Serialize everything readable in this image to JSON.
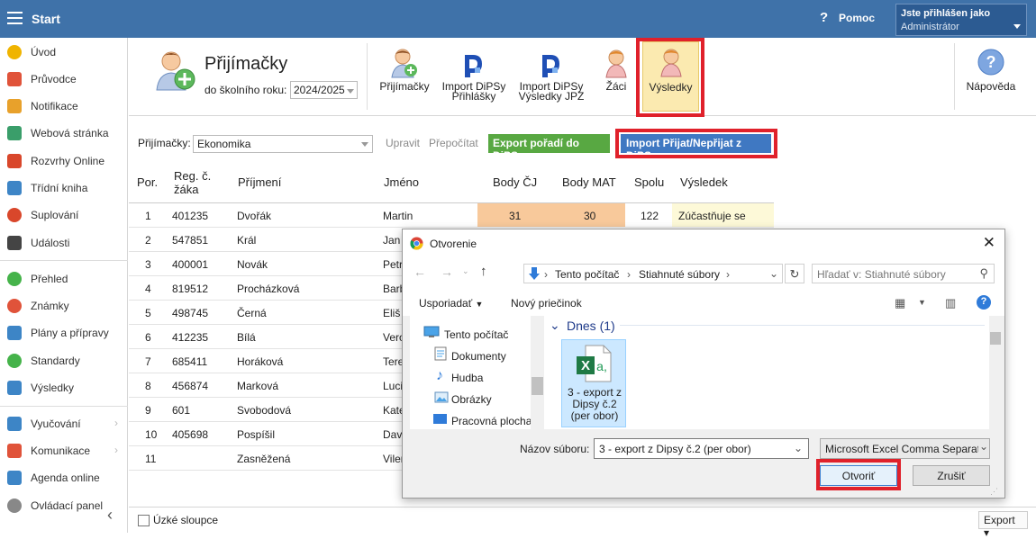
{
  "topbar": {
    "title": "Start",
    "help_label": "Pomoc",
    "help_glyph": "?",
    "user_line1": "Jste přihlášen jako",
    "user_line2": "Administrátor"
  },
  "sidebar": {
    "items": [
      {
        "label": "Úvod",
        "icon": "star-icon",
        "color": "#f0b400"
      },
      {
        "label": "Průvodce",
        "icon": "wand-icon",
        "color": "#e0533a"
      },
      {
        "label": "Notifikace",
        "icon": "envelope-icon",
        "color": "#e8a12b"
      },
      {
        "label": "Webová stránka",
        "icon": "home-icon",
        "color": "#3a9e6a"
      },
      {
        "label": "Rozvrhy Online",
        "icon": "calendar-grid-icon",
        "color": "#d9472b"
      },
      {
        "label": "Třídní kniha",
        "icon": "book-icon",
        "color": "#3d85c6"
      },
      {
        "label": "Suplování",
        "icon": "person-icon",
        "color": "#d9472b"
      },
      {
        "label": "Události",
        "icon": "calendar-icon",
        "color": "#444444"
      },
      {
        "label": "Přehled",
        "icon": "check-circle-icon",
        "color": "#45b34a"
      },
      {
        "label": "Známky",
        "icon": "grade-icon",
        "color": "#e0533a"
      },
      {
        "label": "Plány a přípravy",
        "icon": "briefcase-icon",
        "color": "#3d85c6"
      },
      {
        "label": "Standardy",
        "icon": "shield-check-icon",
        "color": "#45b34a"
      },
      {
        "label": "Výsledky",
        "icon": "bar-chart-icon",
        "color": "#3d85c6"
      },
      {
        "label": "Vyučování",
        "icon": "monitor-icon",
        "color": "#3d85c6"
      },
      {
        "label": "Komunikace",
        "icon": "chat-icon",
        "color": "#e0533a"
      },
      {
        "label": "Agenda online",
        "icon": "pen-icon",
        "color": "#3d85c6"
      },
      {
        "label": "Ovládací panel",
        "icon": "gear-icon",
        "color": "#888888"
      }
    ],
    "collapse_glyph": "‹"
  },
  "header": {
    "title": "Přijímačky",
    "year_label": "do školního roku:",
    "year_value": "2024/2025"
  },
  "toolbar": {
    "btn1": "Přijímačky",
    "btn2_l1": "Import DiPSy",
    "btn2_l2": "Přihlášky",
    "btn3_l1": "Import DiPSy",
    "btn3_l2": "Výsledky JPZ",
    "btn4": "Žáci",
    "btn5": "Výsledky",
    "help": "Nápověda",
    "help_glyph": "?"
  },
  "filter": {
    "label": "Přijímačky:",
    "value": "Ekonomika",
    "edit": "Upravit",
    "recalc": "Přepočítat",
    "export": "Export pořadí do DiPSy",
    "import": "Import Přijat/Nepřijat z DiPSy"
  },
  "table": {
    "headers": {
      "por": "Por.",
      "reg1": "Reg. č.",
      "reg2": "žáka",
      "surname": "Příjmení",
      "name": "Jméno",
      "cj": "Body ČJ",
      "mat": "Body MAT",
      "total": "Spolu",
      "result": "Výsledek"
    },
    "rows": [
      {
        "por": "1",
        "reg": "401235",
        "surname": "Dvořák",
        "name": "Martin",
        "cj": "31",
        "mat": "30",
        "total": "122",
        "result": "Zúčastňuje se"
      },
      {
        "por": "2",
        "reg": "547851",
        "surname": "Král",
        "name": "Jan"
      },
      {
        "por": "3",
        "reg": "400001",
        "surname": "Novák",
        "name": "Petr"
      },
      {
        "por": "4",
        "reg": "819512",
        "surname": "Procházková",
        "name": "Barb"
      },
      {
        "por": "5",
        "reg": "498745",
        "surname": "Černá",
        "name": "Eliš"
      },
      {
        "por": "6",
        "reg": "412235",
        "surname": "Bílá",
        "name": "Vero"
      },
      {
        "por": "7",
        "reg": "685411",
        "surname": "Horáková",
        "name": "Tere"
      },
      {
        "por": "8",
        "reg": "456874",
        "surname": "Marková",
        "name": "Luci"
      },
      {
        "por": "9",
        "reg": "601",
        "surname": "Svobodová",
        "name": "Kate"
      },
      {
        "por": "10",
        "reg": "405698",
        "surname": "Pospíšil",
        "name": "Dav"
      },
      {
        "por": "11",
        "reg": "",
        "surname": "Zasněžená",
        "name": "Vilen"
      }
    ]
  },
  "bottom": {
    "narrow_cols": "Úzké sloupce",
    "export": "Export ▾"
  },
  "dialog": {
    "title": "Otvorenie",
    "close": "✕",
    "crumb1": "Tento počítač",
    "crumb2": "Stiahnuté súbory",
    "search_placeholder": "Hľadať v: Stiahnuté súbory",
    "organize": "Usporiadať",
    "new_folder": "Nový priečinok",
    "tree": [
      "Tento počítač",
      "Dokumenty",
      "Hudba",
      "Obrázky",
      "Pracovná plocha"
    ],
    "group": "Dnes (1)",
    "file_name": "3 - export z Dipsy č.2 (per obor)",
    "file_label_l1": "3 - export z",
    "file_label_l2": "Dipsy č.2",
    "file_label_l3": "(per obor)",
    "filename_label": "Názov súboru:",
    "filetype": "Microsoft Excel Comma Separated Values File",
    "open": "Otvoriť",
    "cancel": "Zrušiť"
  },
  "colors": {
    "topbar": "#3f72a9",
    "highlight_red": "#e0212b",
    "green_button": "#58a842",
    "blue_button": "#3f78c2",
    "orange_cell": "#f8c99b"
  }
}
